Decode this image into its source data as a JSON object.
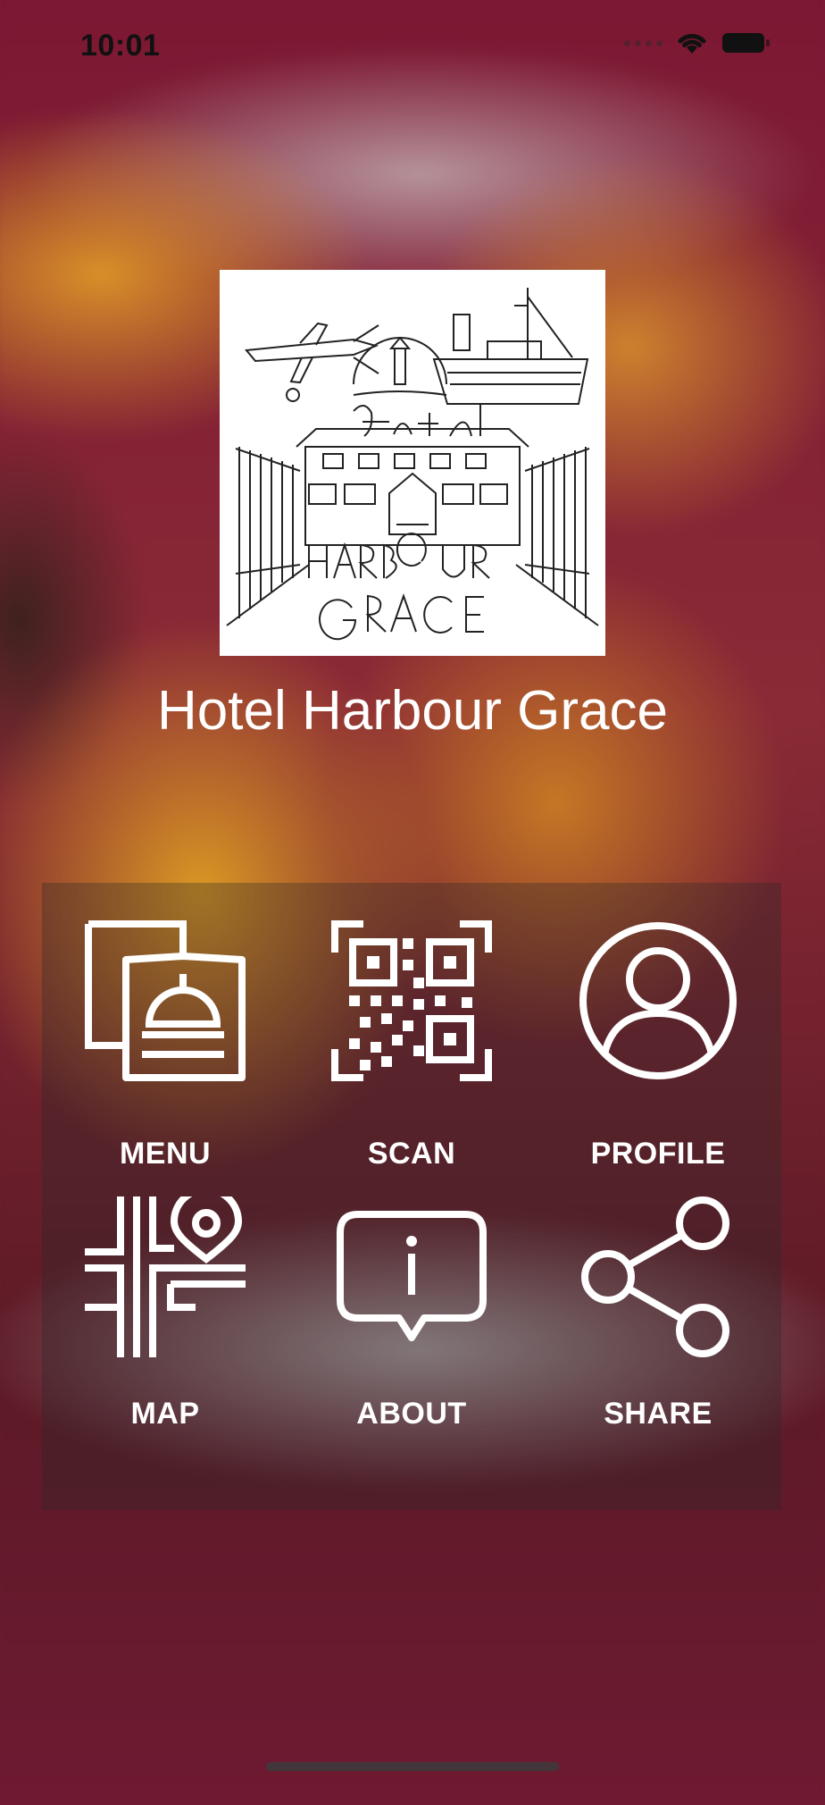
{
  "status_bar": {
    "time": "10:01",
    "icons": [
      "cellular-signal-icon",
      "wifi-icon",
      "battery-icon"
    ]
  },
  "header": {
    "logo_icon": "hotel-harbour-grace-logo",
    "title": "Hotel Harbour Grace"
  },
  "grid": {
    "items": [
      {
        "label": "MENU",
        "icon": "menu-cloche-icon"
      },
      {
        "label": "SCAN",
        "icon": "qr-code-icon"
      },
      {
        "label": "PROFILE",
        "icon": "user-profile-icon"
      },
      {
        "label": "MAP",
        "icon": "map-pin-icon"
      },
      {
        "label": "ABOUT",
        "icon": "info-bubble-icon"
      },
      {
        "label": "SHARE",
        "icon": "share-icon"
      }
    ]
  },
  "colors": {
    "background_tint": "#7a1a36",
    "icon_color": "#ffffff",
    "text_color": "#ffffff"
  }
}
